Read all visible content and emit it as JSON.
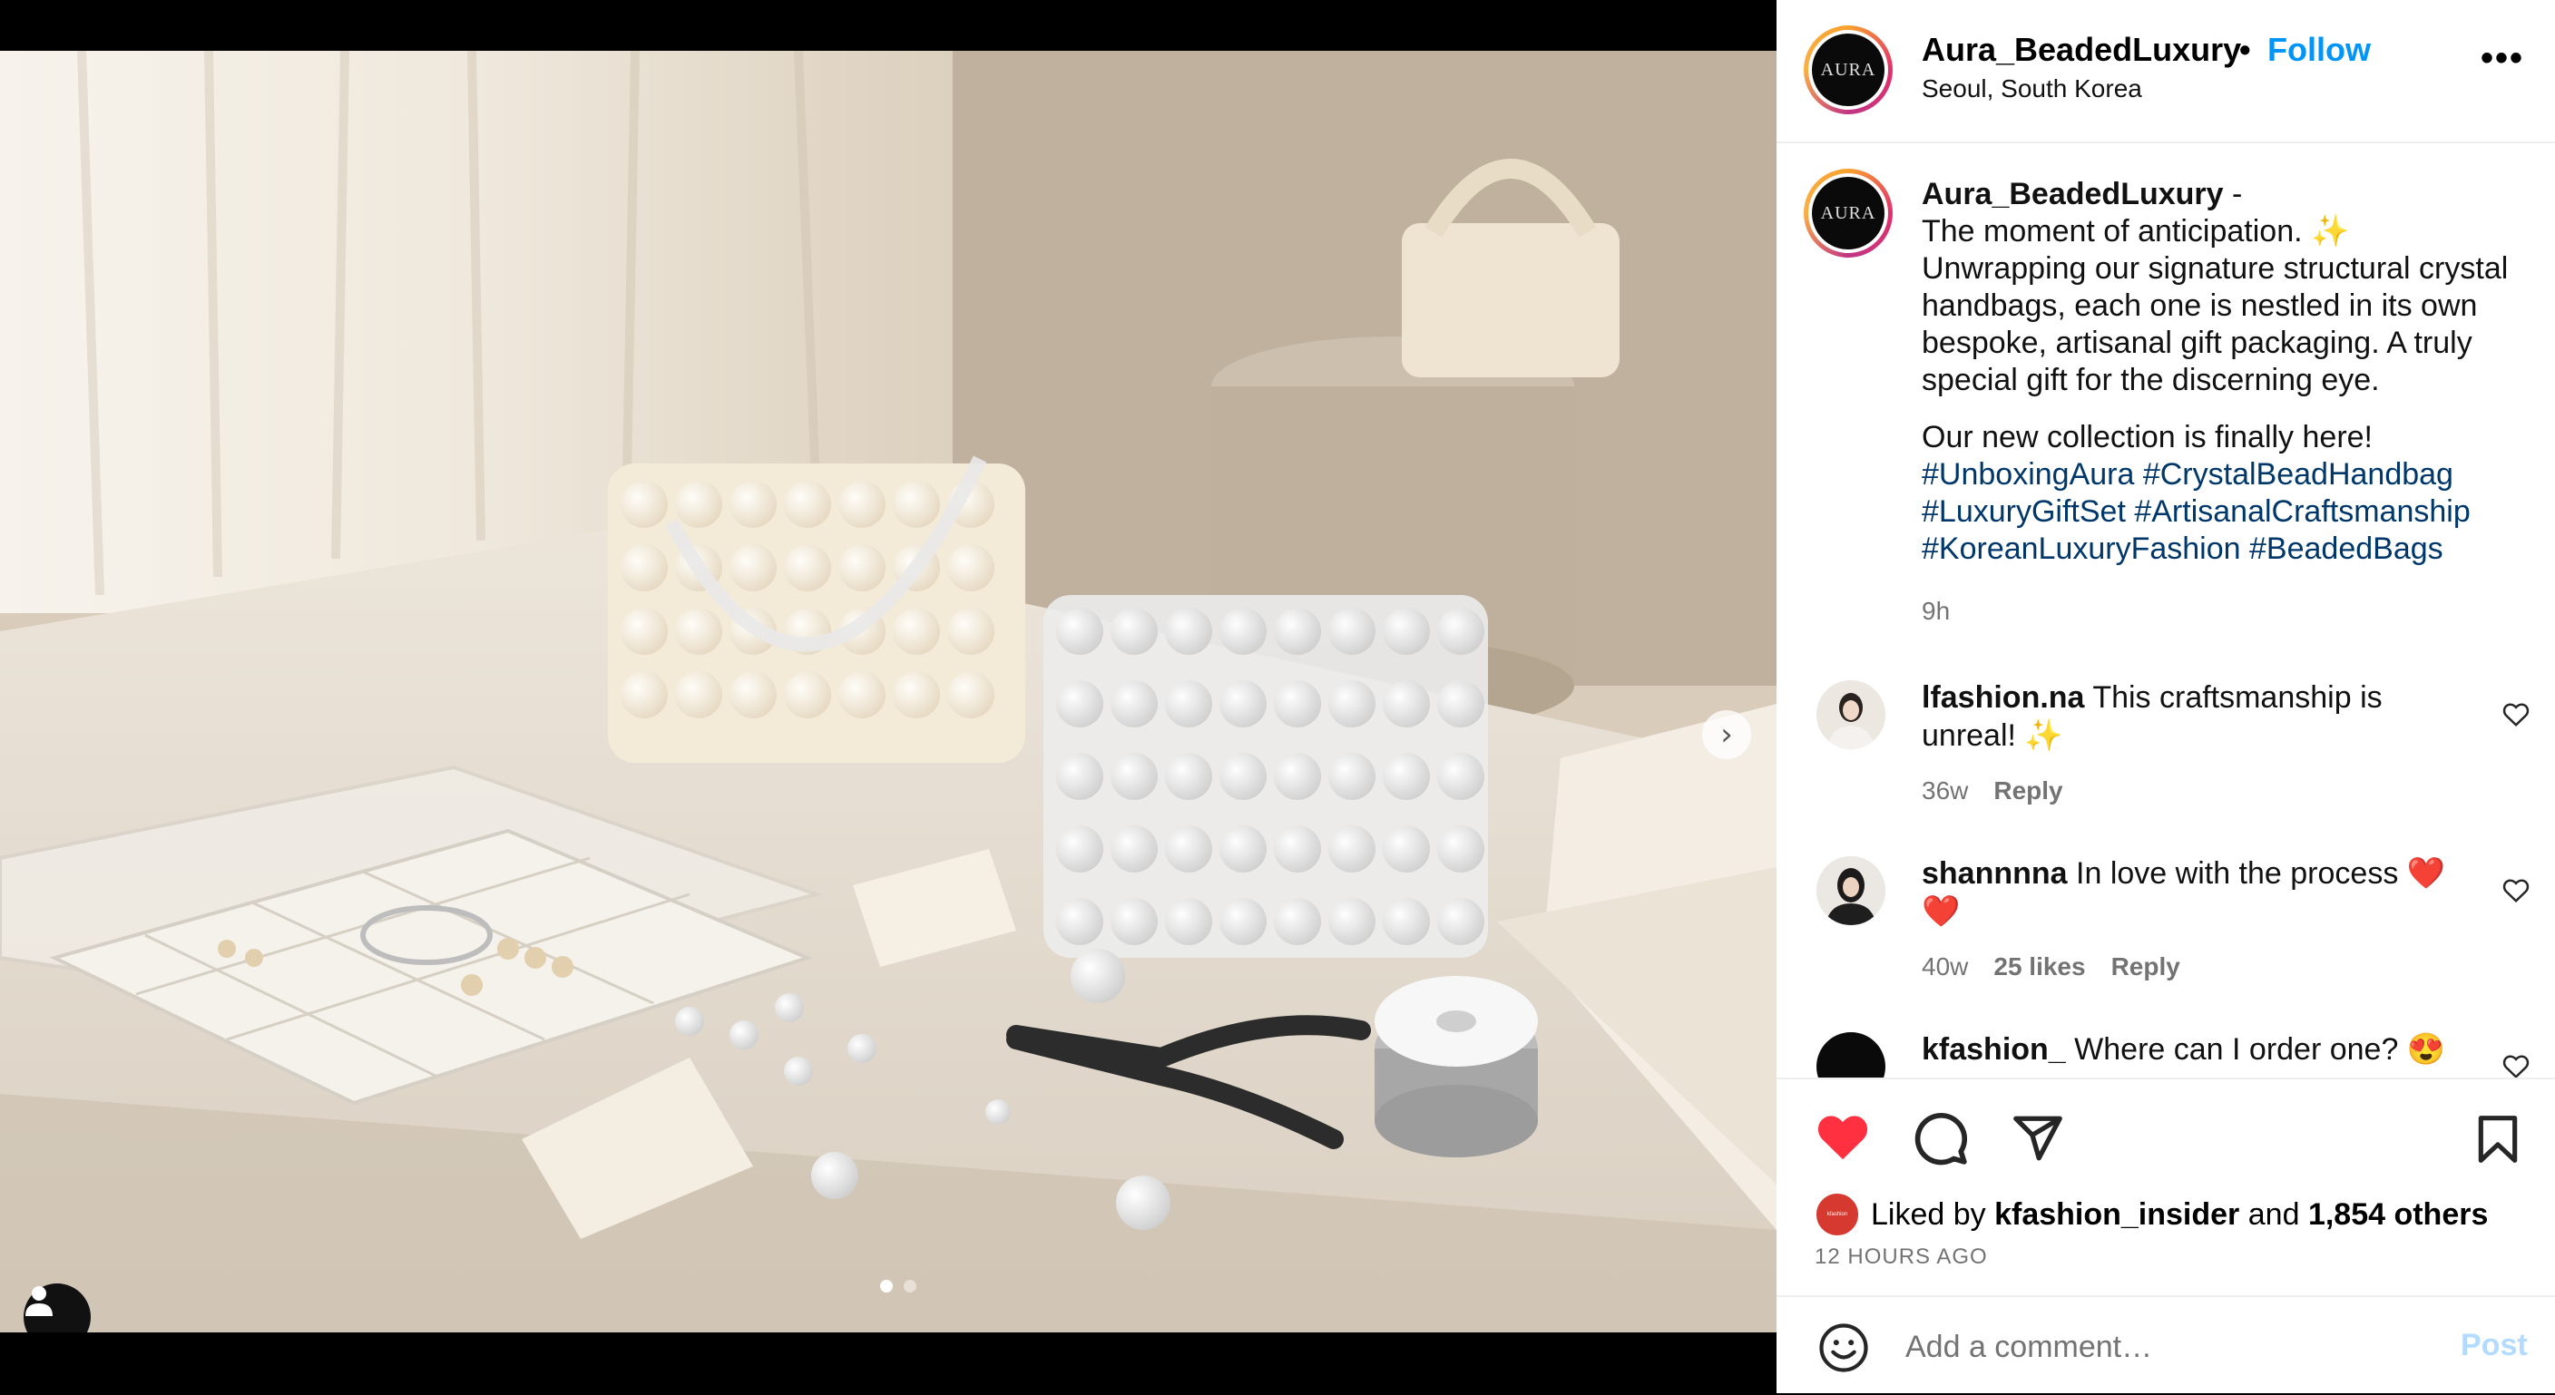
{
  "post": {
    "author": "Aura_BeadedLuxury",
    "avatar_text": "AURA",
    "follow_label": "Follow",
    "separator": "•",
    "location": "Seoul, South Korea",
    "more_label": "•••",
    "carousel": {
      "slide_count": 2,
      "active_slide": 1
    },
    "caption": {
      "author": "Aura_BeadedLuxury",
      "dash": " -",
      "lines": [
        "The moment of anticipation. ✨",
        "Unwrapping our signature structural crystal",
        "handbags, each one is nestled in its own",
        "bespoke, artisanal gift packaging. A truly",
        "special gift for the discerning eye."
      ],
      "line2": "Our new collection is finally here!",
      "hashtags": [
        "#UnboxingAura",
        "#CrystalBeadHandbag",
        "#LuxuryGiftSet",
        "#ArtisanalCraftsmanship",
        "#KoreanLuxuryFashion",
        "#BeadedBags"
      ],
      "time": "9h"
    },
    "comments": [
      {
        "user": "lfashion.na",
        "text": "This craftsmanship is unreal! ✨",
        "time": "36w",
        "likes": "",
        "reply": "Reply"
      },
      {
        "user": "shannnna",
        "text": "In love with the process ❤️ ❤️",
        "time": "40w",
        "likes": "25 likes",
        "reply": "Reply"
      },
      {
        "user": "kfashion_",
        "text": "Where can I order one? 😍",
        "time": "",
        "likes": "",
        "reply": ""
      }
    ],
    "likes": {
      "prefix": "Liked by",
      "user": "kfashion_insider",
      "middle": "and",
      "others": "1,854 others"
    },
    "timestamp": "12 HOURS AGO",
    "add_comment": {
      "placeholder": "Add a comment…",
      "post_label": "Post"
    },
    "colors": {
      "accent": "#0095f6",
      "like": "#ff3040",
      "hashtag": "#00376b",
      "muted": "#737373"
    },
    "icons": [
      "heart-icon",
      "comment-icon",
      "share-icon",
      "bookmark-icon",
      "emoji-icon",
      "chevron-right-icon",
      "user-tag-icon"
    ]
  }
}
